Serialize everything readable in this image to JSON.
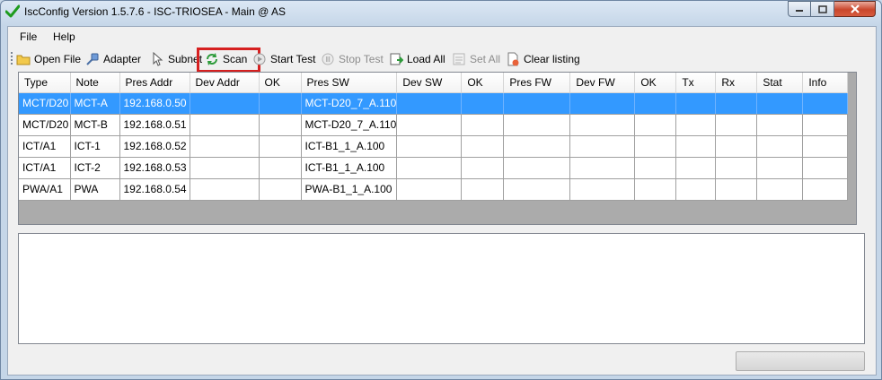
{
  "window": {
    "title": "IscConfig Version 1.5.7.6 - ISC-TRIOSEA - Main @ AS",
    "buttons": [
      "minimize-button",
      "maximize-button",
      "close-button"
    ]
  },
  "menu": {
    "file": "File",
    "help": "Help"
  },
  "toolbar": {
    "open_file": "Open File",
    "adapter": "Adapter",
    "subnet": "Subnet",
    "scan": "Scan",
    "start_test": "Start Test",
    "stop_test": "Stop Test",
    "load_all": "Load All",
    "set_all": "Set All",
    "clear_listing": "Clear listing"
  },
  "grid": {
    "columns": [
      "Type",
      "Note",
      "Pres Addr",
      "Dev Addr",
      "OK",
      "Pres SW",
      "Dev SW",
      "OK",
      "Pres FW",
      "Dev FW",
      "OK",
      "Tx",
      "Rx",
      "Stat",
      "Info"
    ],
    "rows": [
      [
        "MCT/D20",
        "MCT-A",
        "192.168.0.50",
        "",
        "",
        "MCT-D20_7_A.110",
        "",
        "",
        "",
        "",
        "",
        "",
        "",
        "",
        ""
      ],
      [
        "MCT/D20",
        "MCT-B",
        "192.168.0.51",
        "",
        "",
        "MCT-D20_7_A.110",
        "",
        "",
        "",
        "",
        "",
        "",
        "",
        "",
        ""
      ],
      [
        "ICT/A1",
        "ICT-1",
        "192.168.0.52",
        "",
        "",
        "ICT-B1_1_A.100",
        "",
        "",
        "",
        "",
        "",
        "",
        "",
        "",
        ""
      ],
      [
        "ICT/A1",
        "ICT-2",
        "192.168.0.53",
        "",
        "",
        "ICT-B1_1_A.100",
        "",
        "",
        "",
        "",
        "",
        "",
        "",
        "",
        ""
      ],
      [
        "PWA/A1",
        "PWA",
        "192.168.0.54",
        "",
        "",
        "PWA-B1_1_A.100",
        "",
        "",
        "",
        "",
        "",
        "",
        "",
        "",
        ""
      ]
    ],
    "selected_row": 0
  },
  "colors": {
    "selection": "#3399ff",
    "highlight_box": "#d62020"
  }
}
